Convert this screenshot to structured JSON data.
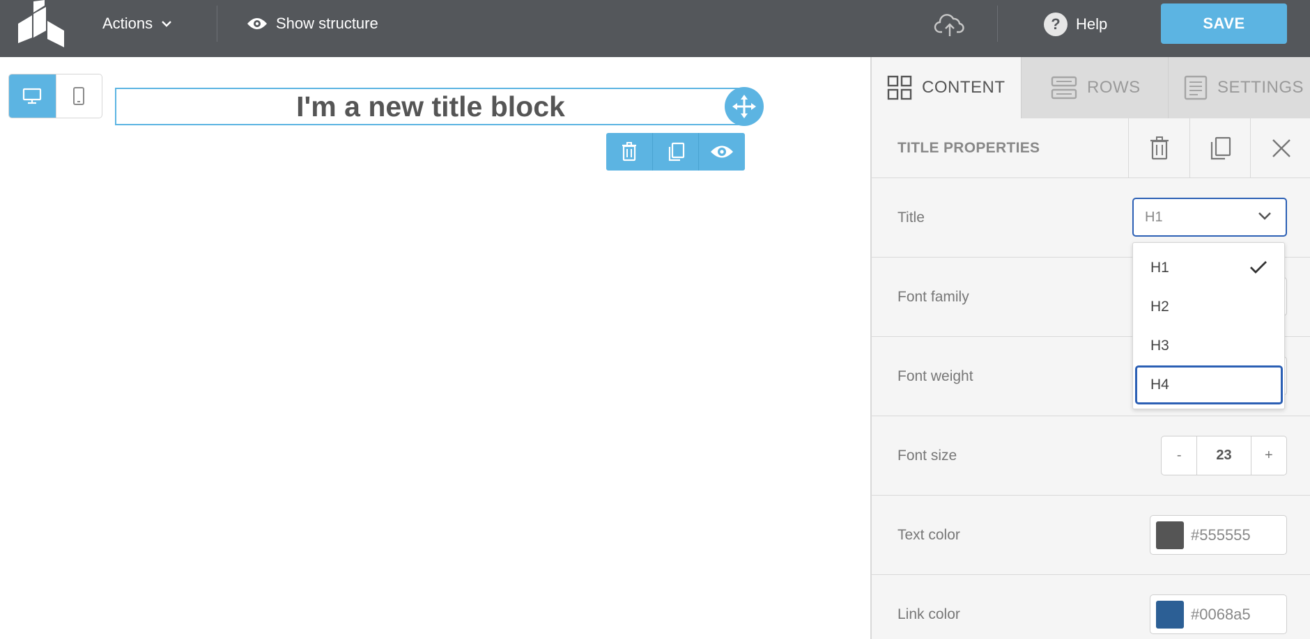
{
  "topbar": {
    "actions_label": "Actions",
    "show_structure_label": "Show structure",
    "help_label": "Help",
    "help_glyph": "?",
    "save_label": "SAVE"
  },
  "canvas": {
    "title_text": "I'm a new title block"
  },
  "tabs": [
    {
      "label": "CONTENT",
      "icon": "grid-icon",
      "active": true
    },
    {
      "label": "ROWS",
      "icon": "rows-icon",
      "active": false
    },
    {
      "label": "SETTINGS",
      "icon": "settings-doc-icon",
      "active": false
    }
  ],
  "properties": {
    "header": "TITLE PROPERTIES",
    "title": {
      "label": "Title",
      "value": "H1"
    },
    "font_family": {
      "label": "Font family"
    },
    "font_weight": {
      "label": "Font weight"
    },
    "font_size": {
      "label": "Font size",
      "value": "23",
      "minus": "-",
      "plus": "+"
    },
    "text_color": {
      "label": "Text color",
      "value": "#555555",
      "swatch": "#555555"
    },
    "link_color": {
      "label": "Link color",
      "value": "#0068a5",
      "swatch": "#2c5f95"
    }
  },
  "dropdown": {
    "options": [
      "H1",
      "H2",
      "H3",
      "H4"
    ],
    "selected": "H1",
    "focused": "H4"
  },
  "colors": {
    "topbar_bg": "#54575b",
    "accent": "#5cb4e2",
    "focus": "#2b5fb4"
  }
}
